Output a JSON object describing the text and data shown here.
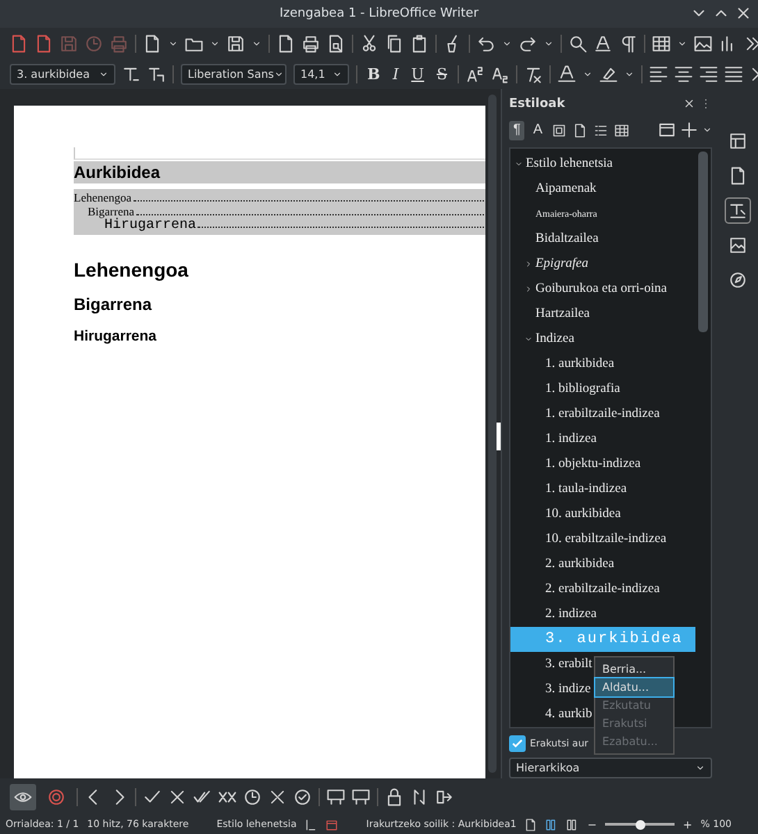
{
  "window": {
    "title": "Izengabea 1 - LibreOffice Writer"
  },
  "toolbar": {
    "paragraph_style": "3. aurkibidea",
    "font_name": "Liberation Sans",
    "font_size": "14,1",
    "format_buttons": [
      {
        "label": "B",
        "kind": "bold"
      },
      {
        "label": "I",
        "kind": "italic"
      },
      {
        "label": "U",
        "kind": "underline"
      },
      {
        "label": "S",
        "kind": "strike"
      }
    ]
  },
  "document": {
    "toc_title": "Aurkibidea",
    "toc_entries": [
      {
        "text": "Lehenengoa",
        "kind": "serif",
        "children": [
          {
            "text": "Bigarrena",
            "kind": "serif",
            "children": [
              {
                "text": "Hirugarrena",
                "kind": "mono"
              }
            ]
          }
        ]
      }
    ],
    "headings": [
      {
        "text": "Lehenengoa",
        "kind": "h1"
      },
      {
        "text": "Bigarrena",
        "kind": "h2"
      },
      {
        "text": "Hirugarrena",
        "kind": "h3"
      }
    ]
  },
  "sidebar": {
    "title": "Estiloak",
    "families": [
      {
        "kind": "text",
        "label": "¶",
        "selected": true
      },
      {
        "kind": "text",
        "label": "A",
        "selected": false
      },
      {
        "kind": "frame",
        "selected": false
      },
      {
        "kind": "page",
        "selected": false
      },
      {
        "kind": "list",
        "selected": false
      },
      {
        "kind": "table",
        "selected": false
      }
    ],
    "tree": [
      {
        "text": "Estilo lehenetsia",
        "kind": "plain",
        "selected": false,
        "expanded": true,
        "children": [
          {
            "text": "Aipamenak",
            "kind": "plain",
            "selected": false
          },
          {
            "text": "Amaiera-oharra",
            "kind": "small",
            "selected": false
          },
          {
            "text": "Bidaltzailea",
            "kind": "plain",
            "selected": false
          },
          {
            "text": "Epigrafea",
            "kind": "italic",
            "selected": false,
            "expanded": false
          },
          {
            "text": "Goiburukoa eta orri-oina",
            "kind": "plain",
            "selected": false,
            "expanded": false
          },
          {
            "text": "Hartzailea",
            "kind": "plain",
            "selected": false
          },
          {
            "text": "Indizea",
            "kind": "plain",
            "selected": false,
            "expanded": true,
            "children": [
              {
                "text": "1. aurkibidea",
                "kind": "plain",
                "selected": false
              },
              {
                "text": "1. bibliografia",
                "kind": "plain",
                "selected": false
              },
              {
                "text": "1. erabiltzaile-indizea",
                "kind": "plain",
                "selected": false
              },
              {
                "text": "1. indizea",
                "kind": "plain",
                "selected": false
              },
              {
                "text": "1. objektu-indizea",
                "kind": "plain",
                "selected": false
              },
              {
                "text": "1. taula-indizea",
                "kind": "plain",
                "selected": false
              },
              {
                "text": "10. aurkibidea",
                "kind": "plain",
                "selected": false
              },
              {
                "text": "10. erabiltzaile-indizea",
                "kind": "plain",
                "selected": false
              },
              {
                "text": "2. aurkibidea",
                "kind": "plain",
                "selected": false
              },
              {
                "text": "2. erabiltzaile-indizea",
                "kind": "plain",
                "selected": false
              },
              {
                "text": "2. indizea",
                "kind": "plain",
                "selected": false
              },
              {
                "text": "3. aurkibidea",
                "kind": "mono",
                "selected": true
              },
              {
                "text": "3. erabilt",
                "kind": "plain",
                "selected": false
              },
              {
                "text": "3. indize",
                "kind": "plain",
                "selected": false
              },
              {
                "text": "4. aurkib",
                "kind": "plain",
                "selected": false
              }
            ]
          }
        ]
      }
    ],
    "preview": {
      "label": "Erakutsi aur",
      "checked": true
    },
    "filter": {
      "value": "Hierarkikoa"
    }
  },
  "context_menu": [
    {
      "label": "Berria...",
      "selected": false,
      "disabled": false
    },
    {
      "label": "Aldatu...",
      "selected": true,
      "disabled": false
    },
    {
      "label": "Ezkutatu",
      "selected": false,
      "disabled": true
    },
    {
      "label": "Erakutsi",
      "selected": false,
      "disabled": true
    },
    {
      "label": "Ezabatu...",
      "selected": false,
      "disabled": true
    }
  ],
  "deck_tabs": [
    {
      "kind": "properties",
      "selected": false
    },
    {
      "kind": "page",
      "selected": false
    },
    {
      "kind": "styles",
      "selected": true
    },
    {
      "kind": "gallery",
      "selected": false
    },
    {
      "kind": "navigator",
      "selected": false
    }
  ],
  "track_toolbar": [
    {
      "kind": "show",
      "selected": true
    },
    {
      "kind": "record",
      "selected": false
    }
  ],
  "status_bar": {
    "page": "Orrialdea: 1 / 1",
    "words": "10 hitz, 76 karaktere",
    "page_style": "Estilo lehenetsia",
    "document": "Irakurtzeko soilik : Aurkibidea1",
    "zoom": {
      "zoom_out": "−",
      "zoom_in": "+",
      "level": 0.5,
      "text": "% 100"
    }
  }
}
